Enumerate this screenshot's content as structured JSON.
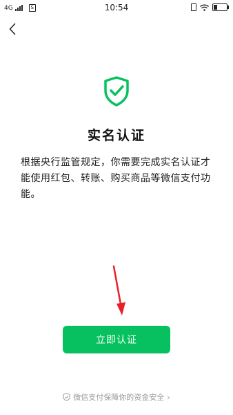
{
  "status_bar": {
    "network": "4G",
    "sim_label": "S",
    "time": "10:54",
    "battery_level": 0.25
  },
  "nav": {
    "back_icon": "chevron-left-icon"
  },
  "main": {
    "icon": "shield-check-icon",
    "title": "实名认证",
    "description": "根据央行监管规定，你需要完成实名认证才能使用红包、转账、购买商品等微信支付功能。",
    "button_label": "立即认证"
  },
  "footer": {
    "icon": "shield-outline-icon",
    "text": "微信支付保障你的资金安全",
    "chevron": "›"
  },
  "colors": {
    "accent": "#07c160",
    "annotation_arrow": "#e8202a",
    "footer_text": "#9a9a9a"
  }
}
